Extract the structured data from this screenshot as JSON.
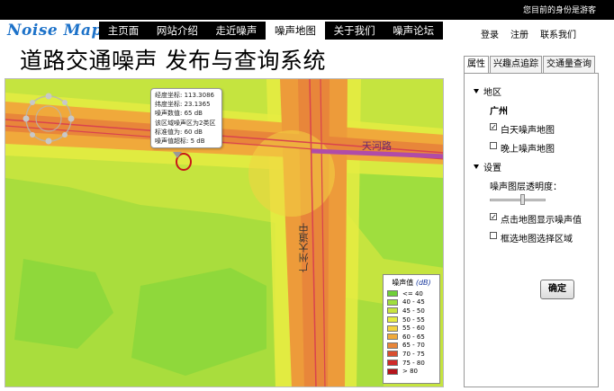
{
  "topbar": {
    "user_status": "您目前的身份是游客"
  },
  "header": {
    "logo": "Noise Map",
    "nav": [
      "主页面",
      "网站介绍",
      "走近噪声",
      "噪声地图",
      "关于我们",
      "噪声论坛"
    ],
    "active_nav": "噪声地图",
    "title": "道路交通噪声 发布与查询系统",
    "account_links": {
      "login": "登录",
      "register": "注册",
      "contact": "联系我们"
    }
  },
  "map": {
    "road_label_east": "天河路",
    "road_label_main": "广州大道中",
    "popup": [
      "经度坐标: 113.3086",
      "纬度坐标: 23.1365",
      "噪声数值: 65 dB",
      "该区域噪声区为2类区",
      "标准值为: 60 dB",
      "噪声值超标: 5 dB"
    ],
    "legend": {
      "title": "噪声值",
      "unit": "(dB)",
      "items": [
        {
          "label": "<= 40",
          "color": "#6fd03a"
        },
        {
          "label": "40 - 45",
          "color": "#9fde3e"
        },
        {
          "label": "45 - 50",
          "color": "#c9e440"
        },
        {
          "label": "50 - 55",
          "color": "#e6ec42"
        },
        {
          "label": "55 - 60",
          "color": "#f3d341"
        },
        {
          "label": "60 - 65",
          "color": "#f0a93b"
        },
        {
          "label": "65 - 70",
          "color": "#e8863a"
        },
        {
          "label": "70 - 75",
          "color": "#d94e30"
        },
        {
          "label": "75 - 80",
          "color": "#cf2a2a"
        },
        {
          "label": "> 80",
          "color": "#b5141c"
        }
      ]
    }
  },
  "panel": {
    "tabs": [
      "属性",
      "兴趣点追踪",
      "交通量查询"
    ],
    "active_tab": "属性",
    "region": {
      "heading": "地区",
      "city": "广州",
      "day_map": {
        "label": "白天噪声地图",
        "checked": true
      },
      "night_map": {
        "label": "晚上噪声地图",
        "checked": false
      }
    },
    "settings": {
      "heading": "设置",
      "opacity_label": "噪声图层透明度：",
      "opacity_value": 0.6,
      "click_show": {
        "label": "点击地图显示噪声值",
        "checked": true
      },
      "box_select": {
        "label": "框选地图选择区域",
        "checked": false
      },
      "ok_label": "确定"
    }
  }
}
